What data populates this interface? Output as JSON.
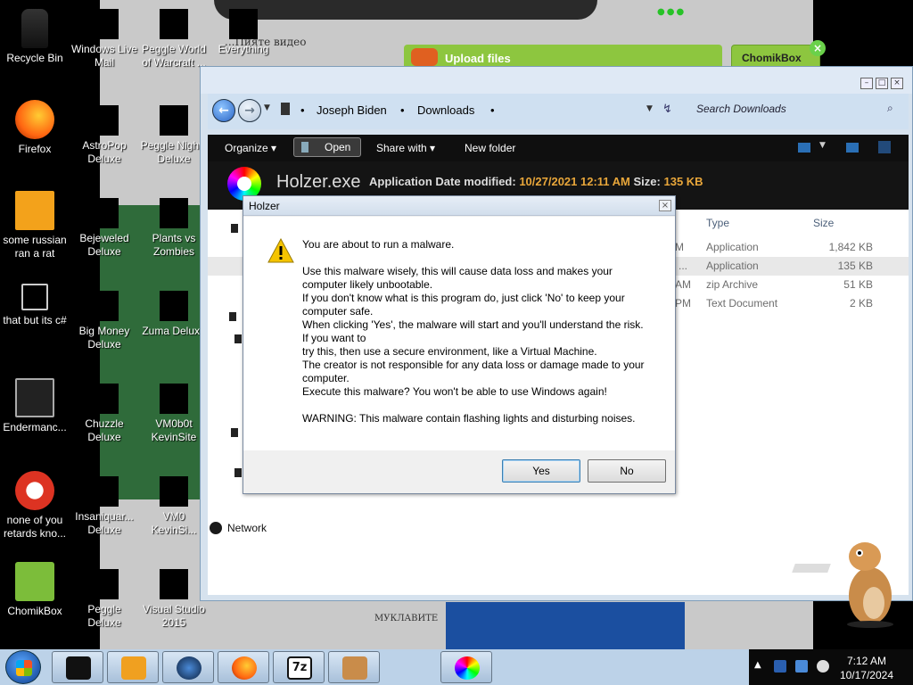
{
  "background_web": {
    "heading_text": "...Пияте видео",
    "upload_label": "Upload files",
    "chomikbox_button": "ChomikBox",
    "close_badge": "×",
    "footer_text": "МУКЛАВИТЕ"
  },
  "desktop_icons": [
    {
      "label": "Recycle Bin",
      "icon": "recycle-bin-icon"
    },
    {
      "label": "Windows Live Mail",
      "icon": "windows-live-mail-icon"
    },
    {
      "label": "Peggle World of Warcraft ...",
      "icon": "peggle-wow-icon"
    },
    {
      "label": "Everything",
      "icon": "everything-icon"
    },
    {
      "label": "Firefox",
      "icon": "firefox-icon"
    },
    {
      "label": "AstroPop Deluxe",
      "icon": "astropop-icon"
    },
    {
      "label": "Peggle Nights Deluxe",
      "icon": "peggle-nights-icon"
    },
    {
      "label": "some russian ran a rat",
      "icon": "file-icon"
    },
    {
      "label": "Bejeweled Deluxe",
      "icon": "bejeweled-icon"
    },
    {
      "label": "Plants vs Zombies",
      "icon": "pvz-icon"
    },
    {
      "label": "that but its c#",
      "icon": "file-icon"
    },
    {
      "label": "Big Money Deluxe",
      "icon": "big-money-icon"
    },
    {
      "label": "Zuma Deluxe",
      "icon": "zuma-icon"
    },
    {
      "label": "Endermanc...",
      "icon": "app-icon"
    },
    {
      "label": "Chuzzle Deluxe",
      "icon": "chuzzle-icon"
    },
    {
      "label": "VM0b0t KevinSite",
      "icon": "vm-icon"
    },
    {
      "label": "none of you retards kno...",
      "icon": "app-icon"
    },
    {
      "label": "Insaniquar... Deluxe",
      "icon": "insaniquarium-icon"
    },
    {
      "label": "VM0 KevinSi...",
      "icon": "vm-icon"
    },
    {
      "label": "ChomikBox",
      "icon": "chomikbox-icon"
    },
    {
      "label": "Peggle Deluxe",
      "icon": "peggle-icon"
    },
    {
      "label": "Visual Studio 2015",
      "icon": "visual-studio-icon"
    }
  ],
  "explorer": {
    "breadcrumb": [
      "Joseph Biden",
      "Downloads"
    ],
    "search_placeholder": "Search Downloads",
    "toolbar": {
      "organize": "Organize",
      "open": "Open",
      "share_with": "Share with",
      "new_folder": "New folder"
    },
    "details": {
      "file_name": "Holzer.exe",
      "file_type": "Application",
      "date_label": "Date modified:",
      "date_value": "10/27/2021 12:11 AM",
      "size_label": "Size:",
      "size_value": "135 KB"
    },
    "columns": {
      "type": "Type",
      "size": "Size"
    },
    "rows": [
      {
        "time_fragment": "M",
        "type": "Application",
        "size": "1,842 KB"
      },
      {
        "time_fragment": "...",
        "type": "Application",
        "size": "135 KB"
      },
      {
        "time_fragment": "AM",
        "type": "zip Archive",
        "size": "51 KB"
      },
      {
        "time_fragment": "PM",
        "type": "Text Document",
        "size": "2 KB"
      }
    ],
    "network_label": "Network"
  },
  "dialog": {
    "title": "Holzer",
    "lines": [
      "You are about to run a malware.",
      "",
      "Use this malware wisely, this will cause data loss and makes your computer likely unbootable.",
      "If you don't know what is this program do, just click 'No' to keep your computer safe.",
      "When clicking 'Yes', the malware will start and you'll understand the risk. If you want to",
      "try this, then use a secure environment, like a Virtual Machine.",
      "The creator is not responsible for any data loss or damage made to your computer.",
      "Execute this malware? You won't be able to use Windows again!",
      "",
      "WARNING: This malware contain flashing lights and disturbing noises."
    ],
    "yes_label": "Yes",
    "no_label": "No"
  },
  "hamster_caption": "",
  "taskbar": {
    "clock_time": "7:12 AM",
    "clock_date": "10/17/2024",
    "buttons": [
      "cmd-icon",
      "media-player-icon",
      "browser-icon",
      "firefox-icon",
      "7zip-icon",
      "chomikbox-icon",
      "holzer-icon"
    ]
  }
}
